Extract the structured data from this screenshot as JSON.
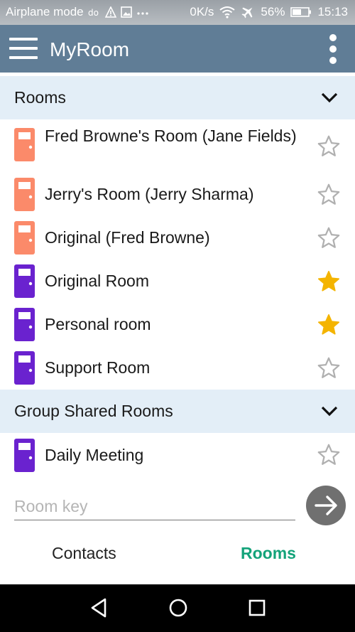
{
  "status_bar": {
    "left_text": "Airplane mode",
    "right_speed": "0K/s",
    "battery": "56%",
    "time": "15:13",
    "icons": [
      "volte-icon",
      "warning-icon",
      "image-icon",
      "more-dots-icon",
      "wifi-icon",
      "airplane-icon",
      "battery-icon"
    ]
  },
  "app_bar": {
    "title": "MyRoom",
    "menu_icon": "hamburger-icon",
    "more_icon": "kebab-icon"
  },
  "sections": [
    {
      "label": "Rooms",
      "rooms": [
        {
          "name": "Fred Browne's Room (Jane Fields)",
          "door_color": "#fb8a6a",
          "favorite": false
        },
        {
          "name": "Jerry's Room (Jerry Sharma)",
          "door_color": "#fb8a6a",
          "favorite": false
        },
        {
          "name": "Original (Fred Browne)",
          "door_color": "#fb8a6a",
          "favorite": false
        },
        {
          "name": "Original Room",
          "door_color": "#6a22cf",
          "favorite": true
        },
        {
          "name": "Personal room",
          "door_color": "#6a22cf",
          "favorite": true
        },
        {
          "name": "Support Room",
          "door_color": "#6a22cf",
          "favorite": false
        }
      ]
    },
    {
      "label": "Group Shared Rooms",
      "rooms": [
        {
          "name": "Daily Meeting",
          "door_color": "#6a22cf",
          "favorite": false
        }
      ]
    }
  ],
  "room_key": {
    "placeholder": "Room key",
    "value": ""
  },
  "tabs": [
    {
      "label": "Contacts",
      "active": false
    },
    {
      "label": "Rooms",
      "active": true
    }
  ],
  "colors": {
    "app_bar": "#607d96",
    "section_bg": "#e3eef7",
    "star_filled": "#f4b400",
    "star_empty": "#b0b0b0",
    "active_tab": "#13a37a"
  }
}
